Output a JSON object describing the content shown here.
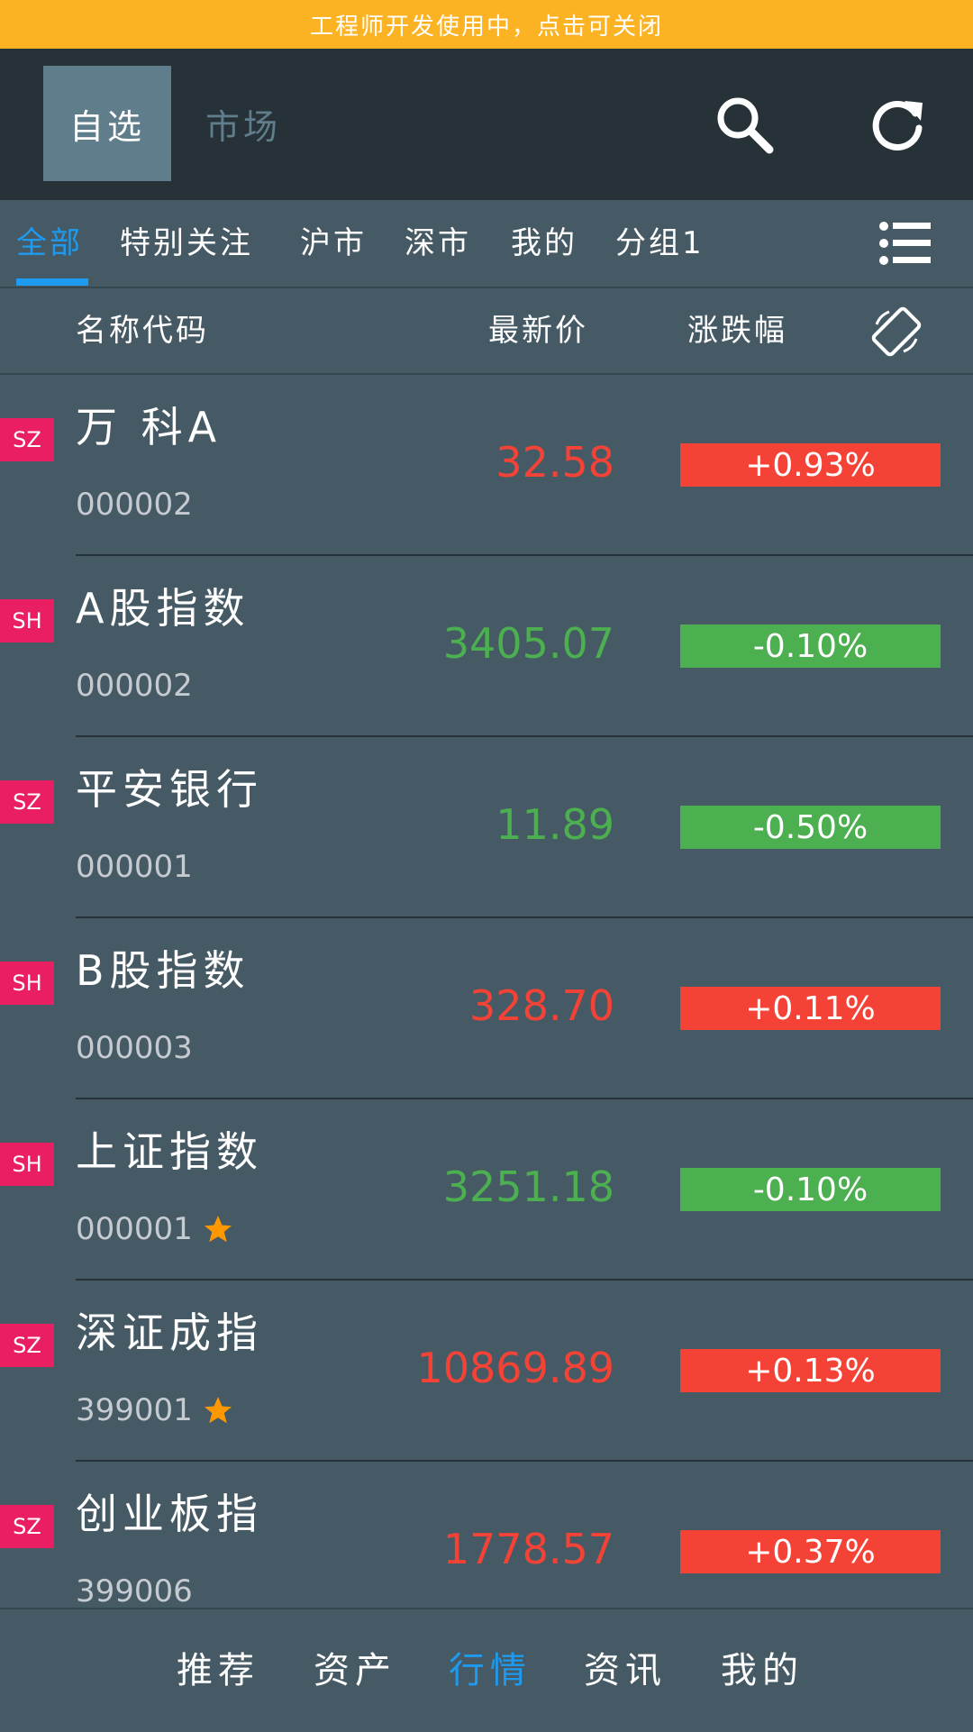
{
  "banner": {
    "text": "工程师开发使用中，点击可关闭"
  },
  "topbar": {
    "segments": [
      "自选",
      "市场"
    ],
    "search_icon": "search-icon",
    "refresh_icon": "refresh-icon"
  },
  "tabs": {
    "items": [
      "全部",
      "特别关注",
      "沪市",
      "深市",
      "我的",
      "分组1"
    ],
    "active_index": 0,
    "menu_icon": "list-menu-icon"
  },
  "columns": {
    "name": "名称代码",
    "price": "最新价",
    "change": "涨跌幅",
    "toggle_icon": "screen-rotation-icon"
  },
  "colors": {
    "up": "#f44336",
    "down": "#4caf50",
    "accent": "#1e9bf0",
    "banner": "#fbb323",
    "tag": "#e91e63",
    "star": "#ff9800"
  },
  "stocks": [
    {
      "market": "SZ",
      "name": "万 科A",
      "code": "000002",
      "price": "32.58",
      "change": "+0.93%",
      "trend": "up",
      "starred": false
    },
    {
      "market": "SH",
      "name": "A股指数",
      "code": "000002",
      "price": "3405.07",
      "change": "-0.10%",
      "trend": "down",
      "starred": false
    },
    {
      "market": "SZ",
      "name": "平安银行",
      "code": "000001",
      "price": "11.89",
      "change": "-0.50%",
      "trend": "down",
      "starred": false
    },
    {
      "market": "SH",
      "name": "B股指数",
      "code": "000003",
      "price": "328.70",
      "change": "+0.11%",
      "trend": "up",
      "starred": false
    },
    {
      "market": "SH",
      "name": "上证指数",
      "code": "000001",
      "price": "3251.18",
      "change": "-0.10%",
      "trend": "down",
      "starred": true
    },
    {
      "market": "SZ",
      "name": "深证成指",
      "code": "399001",
      "price": "10869.89",
      "change": "+0.13%",
      "trend": "up",
      "starred": true
    },
    {
      "market": "SZ",
      "name": "创业板指",
      "code": "399006",
      "price": "1778.57",
      "change": "+0.37%",
      "trend": "up",
      "starred": false
    }
  ],
  "bottom_nav": {
    "items": [
      "推荐",
      "资产",
      "行情",
      "资讯",
      "我的"
    ],
    "active_index": 2
  }
}
